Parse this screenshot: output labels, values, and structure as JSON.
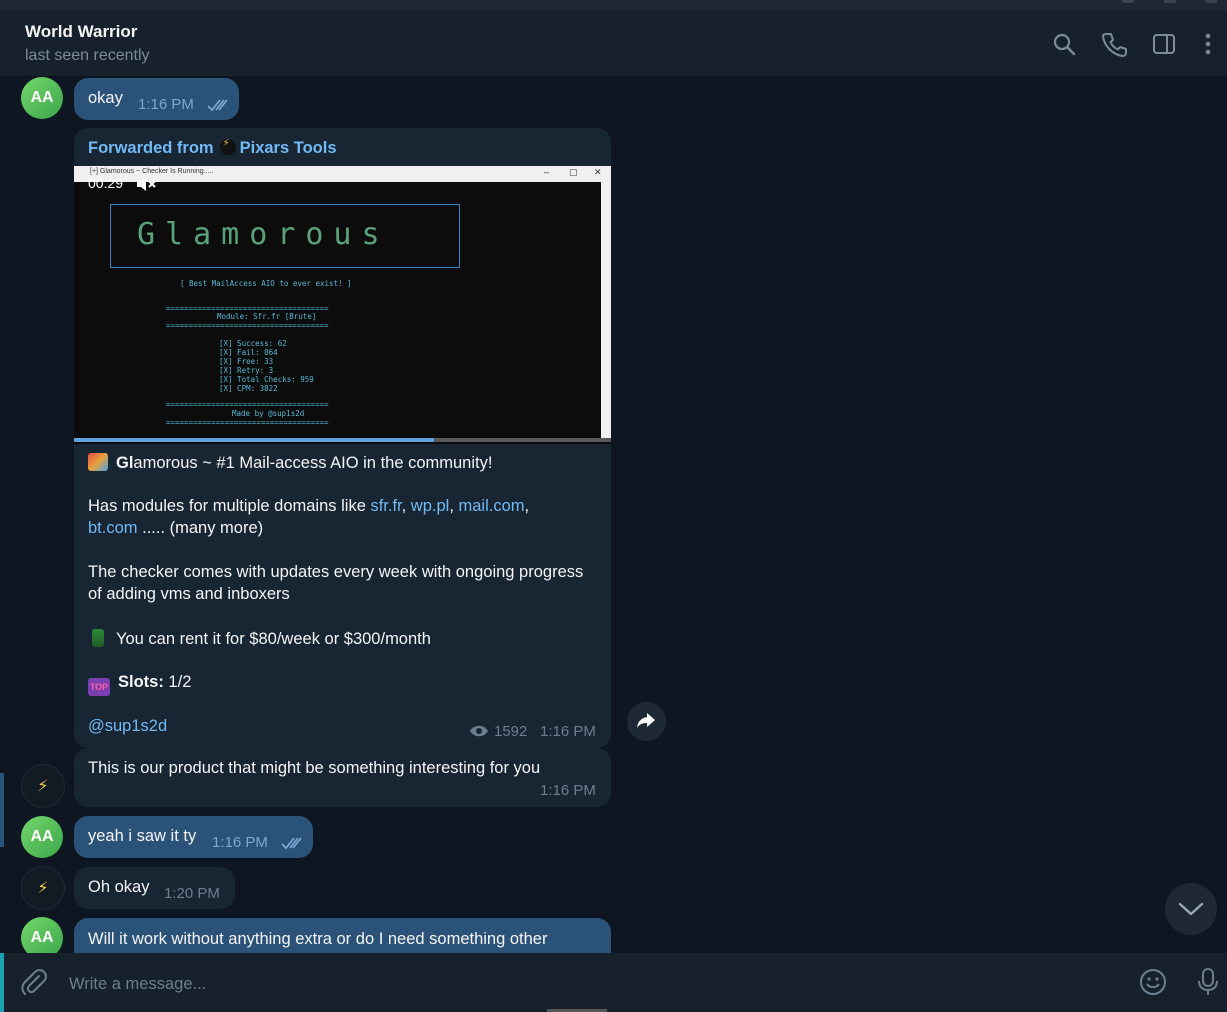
{
  "header": {
    "title": "World Warrior",
    "status": "last seen recently"
  },
  "messages": {
    "m1": {
      "avatar": "AA",
      "text": "okay",
      "time": "1:16 PM"
    },
    "forwarded": {
      "label": "Forwarded from",
      "source": "Pixars Tools",
      "video": {
        "duration": "00:29",
        "window_title": "[+] Glamorous ~ Checker Is Running.....",
        "banner": "[ Best MailAccess AIO to ever exist! ]",
        "module": "Module: Sfr.fr [Brute]",
        "stats": [
          "[X] Success: 62",
          "[X] Fail: 864",
          "[X] Free: 33",
          "[X] Retry: 3",
          "[X] Total Checks: 959",
          "[X] CPM: 3822"
        ],
        "made_by": "Made by @sup1s2d",
        "logo_text": "Glamorous",
        "progress": 0.67
      },
      "line1_bold": "Gl",
      "line1_rest": "amorous ~ #1 Mail-access AIO in the community!",
      "line2_prefix": "Has modules for multiple domains like ",
      "domain1": "sfr.fr",
      "domain2": "wp.pl",
      "domain3": "mail.com",
      "domain4": "bt.com",
      "line3_suffix": " ..... (many more)",
      "line4": "The checker comes with updates every week with ongoing progress",
      "line5": "of adding vms and inboxers",
      "line6": "You can rent it for $80/week or $300/month",
      "slots_label": "Slots:",
      "slots_value": " 1/2",
      "handle": "@sup1s2d",
      "views": "1592",
      "time": "1:16 PM"
    },
    "m3": {
      "text": "This is our product that might be something interesting for you",
      "time": "1:16 PM"
    },
    "m4": {
      "avatar": "AA",
      "text": "yeah i saw it ty",
      "time": "1:16 PM"
    },
    "m5": {
      "text": "Oh okay",
      "time": "1:20 PM"
    },
    "m6": {
      "avatar": "AA",
      "text": "Will it work without anything extra or do I need something other"
    }
  },
  "composer": {
    "placeholder": "Write a message..."
  },
  "colors": {
    "background": "#0e1621",
    "header": "#17212b",
    "incoming_bubble": "#182533",
    "outgoing_bubble": "#2b5278",
    "link": "#71baf5",
    "accent": "#19a3b0"
  },
  "icons": [
    "search-icon",
    "phone-icon",
    "sidebar-icon",
    "more-icon",
    "share-icon",
    "chevron-down-icon",
    "attach-icon",
    "emoji-icon",
    "mic-icon",
    "read-ticks-icon",
    "eye-icon",
    "mute-icon"
  ]
}
